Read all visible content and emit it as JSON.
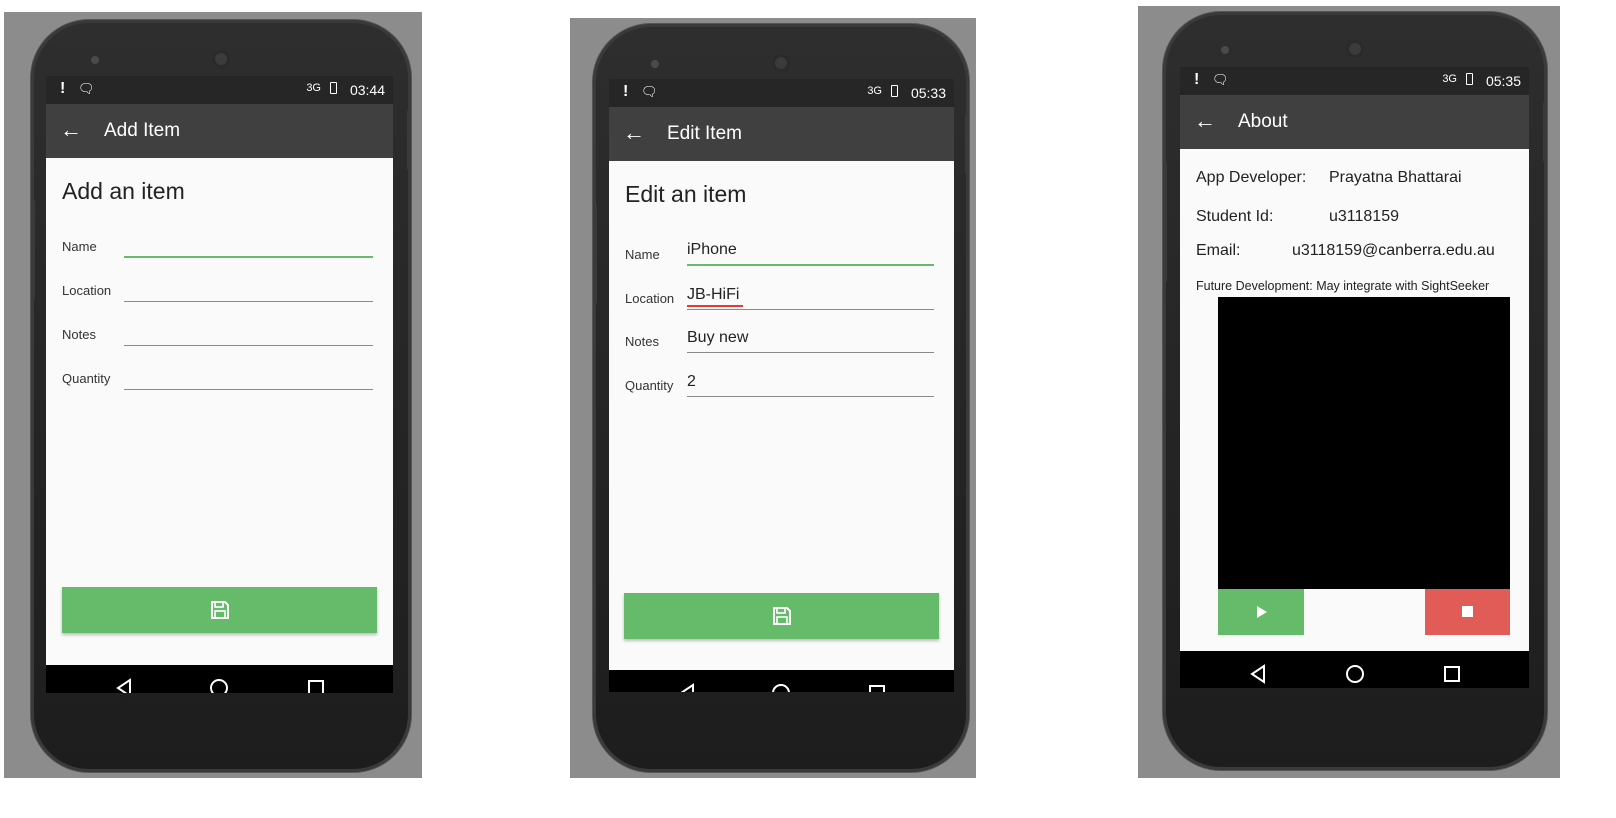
{
  "screens": [
    {
      "status": {
        "alert": "!",
        "time": "03:44",
        "network": "3G"
      },
      "appbar": {
        "back_icon": "arrow-left-icon",
        "title": "Add Item"
      },
      "heading": "Add an item",
      "fields": [
        {
          "label": "Name",
          "value": ""
        },
        {
          "label": "Location",
          "value": ""
        },
        {
          "label": "Notes",
          "value": ""
        },
        {
          "label": "Quantity",
          "value": ""
        }
      ],
      "save_icon": "floppy-disk-icon"
    },
    {
      "status": {
        "alert": "!",
        "time": "05:33",
        "network": "3G"
      },
      "appbar": {
        "back_icon": "arrow-left-icon",
        "title": "Edit Item"
      },
      "heading": "Edit an item",
      "fields": [
        {
          "label": "Name",
          "value": "iPhone"
        },
        {
          "label": "Location",
          "value": "JB-HiFi"
        },
        {
          "label": "Notes",
          "value": "Buy new"
        },
        {
          "label": "Quantity",
          "value": "2"
        }
      ],
      "save_icon": "floppy-disk-icon"
    },
    {
      "status": {
        "alert": "!",
        "time": "05:35",
        "network": "3G"
      },
      "appbar": {
        "back_icon": "arrow-left-icon",
        "title": "About"
      },
      "developer": {
        "label": "App Developer:",
        "value": "Prayatna Bhattarai"
      },
      "student": {
        "label": "Student Id:",
        "value": "u3118159"
      },
      "email": {
        "label": "Email:",
        "value": "u3118159@canberra.edu.au"
      },
      "future": "Future Development: May integrate with SightSeeker",
      "play_icon": "play-icon",
      "stop_icon": "stop-icon"
    }
  ],
  "navbar": {
    "back": "nav-back-icon",
    "home": "nav-home-icon",
    "recents": "nav-recents-icon"
  },
  "colors": {
    "accent": "#66bb6a",
    "appbar": "#404040",
    "stop": "#e15b57",
    "spellcheck": "#e53935"
  }
}
